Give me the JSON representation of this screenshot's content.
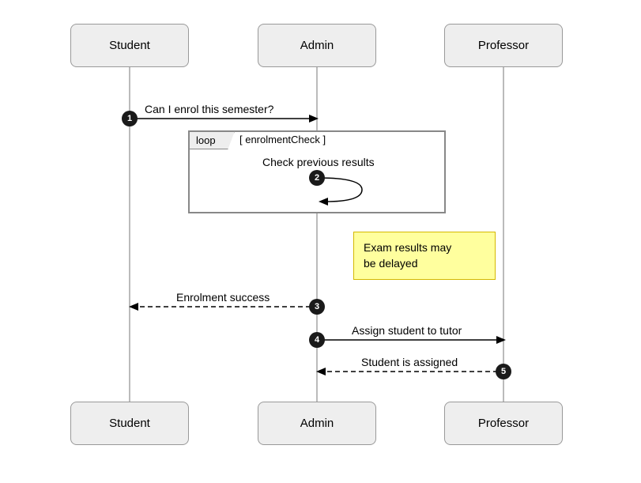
{
  "participants": [
    {
      "id": "student",
      "label": "Student"
    },
    {
      "id": "admin",
      "label": "Admin"
    },
    {
      "id": "professor",
      "label": "Professor"
    }
  ],
  "messages": [
    {
      "seq": "1",
      "from": "student",
      "to": "admin",
      "label": "Can I enrol this semester?",
      "style": "solid"
    },
    {
      "seq": "2",
      "from": "admin",
      "to": "admin",
      "label": "Check previous results",
      "style": "self"
    },
    {
      "seq": "3",
      "from": "admin",
      "to": "student",
      "label": "Enrolment success",
      "style": "dashed"
    },
    {
      "seq": "4",
      "from": "admin",
      "to": "professor",
      "label": "Assign student to tutor",
      "style": "solid"
    },
    {
      "seq": "5",
      "from": "professor",
      "to": "admin",
      "label": "Student is assigned",
      "style": "dashed"
    }
  ],
  "fragment": {
    "type": "loop",
    "type_label": "loop",
    "condition": "[ enrolmentCheck ]"
  },
  "note": {
    "line1": "Exam results may",
    "line2": "be delayed"
  },
  "colors": {
    "actor_fill": "#eeeeee",
    "actor_border": "#999999",
    "note_fill": "#FFFF9E",
    "note_border": "#d4b800",
    "dot_fill": "#1a1a1a"
  }
}
